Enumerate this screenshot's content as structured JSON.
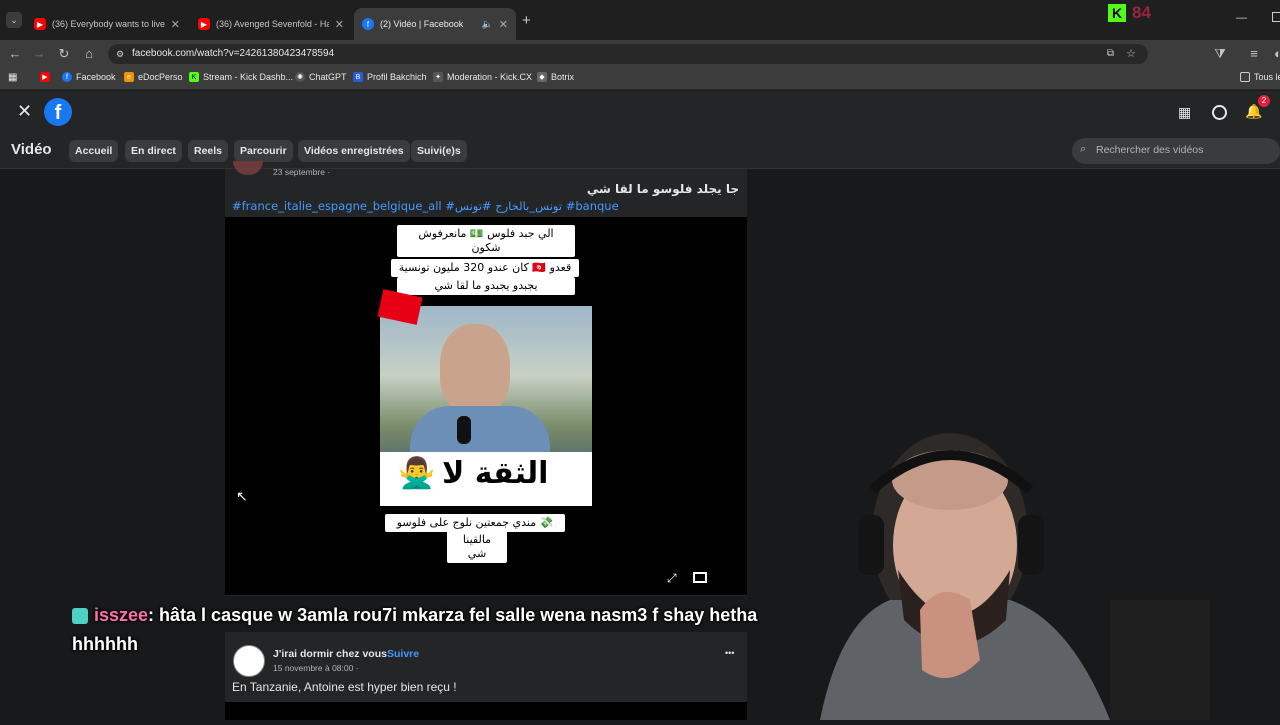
{
  "browser": {
    "tabs": [
      {
        "title": "(36) Everybody wants to live to",
        "favicon": "youtube-icon",
        "color": "#ff0000"
      },
      {
        "title": "(36) Avenged Sevenfold - Hail T",
        "favicon": "youtube-icon",
        "color": "#ff0000"
      },
      {
        "title": "(2) Vidéo | Facebook",
        "favicon": "facebook-icon",
        "color": "#1877f2"
      }
    ],
    "new_tab": "+",
    "url": "facebook.com/watch?v=2426138042347859​4",
    "kick_counter": "84",
    "bookmarks": [
      {
        "label": "",
        "icon": "youtube-icon"
      },
      {
        "label": "Facebook",
        "icon": "facebook-icon"
      },
      {
        "label": "eDocPerso",
        "icon": "edoc-icon"
      },
      {
        "label": "Stream - Kick Dashb...",
        "icon": "kick-icon"
      },
      {
        "label": "ChatGPT",
        "icon": "chatgpt-icon"
      },
      {
        "label": "Profil Bakchich",
        "icon": "b-icon"
      },
      {
        "label": "Moderation - Kick.CX",
        "icon": "mod-icon"
      },
      {
        "label": "Botrix",
        "icon": "botrix-icon"
      }
    ],
    "all_bookmarks": "Tous le"
  },
  "facebook": {
    "notification_count": "2",
    "section_title": "Vidéo",
    "nav": [
      "Accueil",
      "En direct",
      "Reels",
      "Parcourir",
      "Vidéos enregistrées",
      "Suivi(e)s"
    ],
    "search_placeholder": "Rechercher des vidéos",
    "post1": {
      "date": "23 septembre ·",
      "text": "جا يجلد فلوسو ما لقا شي",
      "hashtags": "#france_italie_espagne_belgique_all #تونس_بالخارج #تونس #banque",
      "captions": [
        "الي جبد فلوس 💵 مانعرفوش شكون",
        "كان عندو 320 مليون تونسية 🇹🇳 قعدو",
        "يجبدو يجبدو ما لقا شي",
        "الثقة لا",
        "مندي جمعتين نلوج على فلوسو 💸",
        "مالقينا شي"
      ]
    },
    "post2": {
      "page": "J'irai dormir chez vous",
      "follow": "Suivre",
      "date": "15 novembre à 08:00 ·",
      "text": "En Tanzanie, Antoine est hyper bien reçu !",
      "more": "•••"
    }
  },
  "chat": {
    "user": "isszee",
    "message": ": hâta l casque w 3amla rou7i mkarza fel salle wena nasm3 f shay hetha hhhhhh"
  }
}
